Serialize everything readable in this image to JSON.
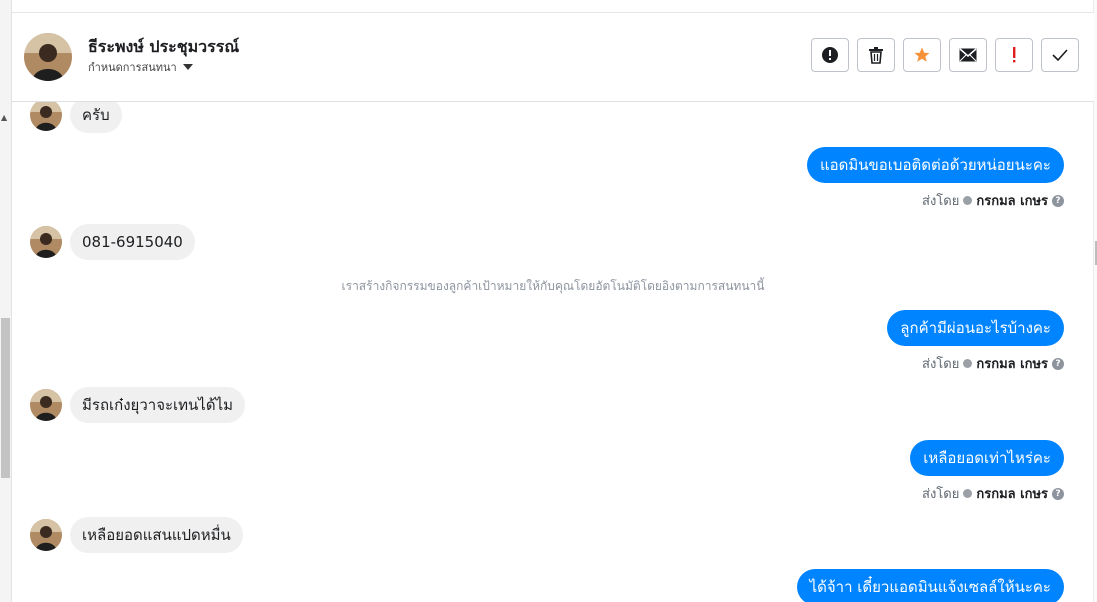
{
  "header": {
    "contact_name": "ธีระพงษ์ ประชุมวรรณ์",
    "assign_label": "กำหนดการสนทนา",
    "actions": [
      {
        "name": "spam-button",
        "icon": "exclamation-circle-icon"
      },
      {
        "name": "delete-button",
        "icon": "trash-icon"
      },
      {
        "name": "star-button",
        "icon": "star-icon",
        "color": "#f7923a"
      },
      {
        "name": "mark-unread-button",
        "icon": "envelope-icon"
      },
      {
        "name": "follow-up-button",
        "icon": "exclamation-icon",
        "color": "#e02020"
      },
      {
        "name": "done-button",
        "icon": "check-icon"
      }
    ]
  },
  "messages": {
    "m1": "ครับ",
    "m2": "แอดมินขอเบอติดต่อด้วยหน่อยนะคะ",
    "m3": "081-6915040",
    "m4": "ลูกค้ามีผ่อนอะไรบ้างคะ",
    "m5": "มีรถเก๋งยุวาจะเทนได้ไม",
    "m6": "เหลือยอดเท่าไหร่คะ",
    "m7": "เหลือยอดแสนแปดหมื่น",
    "m8": "ได้จ้าา เดี๋ยวแอดมินแจ้งเซลล์ให้นะคะ"
  },
  "sent_by": {
    "prefix": "ส่งโดย",
    "agent": "กรกมล เกษร"
  },
  "system_note": "เราสร้างกิจกรรมของลูกค้าเป้าหมายให้กับคุณโดยอัตโนมัติโดยอิงตามการสนทนานี้",
  "colors": {
    "outgoing_bubble": "#0084ff",
    "incoming_bubble": "#f0f0f0"
  }
}
